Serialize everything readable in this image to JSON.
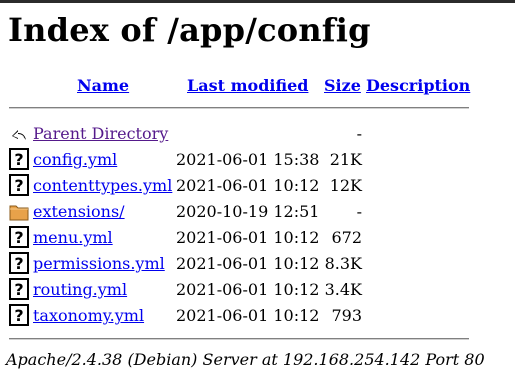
{
  "page": {
    "title": "Index of /app/config"
  },
  "columns": {
    "name": "Name",
    "last_modified": "Last modified",
    "size": "Size",
    "description": "Description"
  },
  "rows": [
    {
      "name": "Parent Directory",
      "modified": "",
      "size": "-",
      "icon": "back-arrow-icon"
    },
    {
      "name": "config.yml",
      "modified": "2021-06-01 15:38",
      "size": "21K",
      "icon": "unknown-file-icon"
    },
    {
      "name": "contenttypes.yml",
      "modified": "2021-06-01 10:12",
      "size": "12K",
      "icon": "unknown-file-icon"
    },
    {
      "name": "extensions/",
      "modified": "2020-10-19 12:51",
      "size": "-",
      "icon": "folder-icon"
    },
    {
      "name": "menu.yml",
      "modified": "2021-06-01 10:12",
      "size": "672",
      "icon": "unknown-file-icon"
    },
    {
      "name": "permissions.yml",
      "modified": "2021-06-01 10:12",
      "size": "8.3K",
      "icon": "unknown-file-icon"
    },
    {
      "name": "routing.yml",
      "modified": "2021-06-01 10:12",
      "size": "3.4K",
      "icon": "unknown-file-icon"
    },
    {
      "name": "taxonomy.yml",
      "modified": "2021-06-01 10:12",
      "size": "793",
      "icon": "unknown-file-icon"
    }
  ],
  "footer": {
    "address": "Apache/2.4.38 (Debian) Server at 192.168.254.142 Port 80"
  },
  "colors": {
    "link": "#0000ee",
    "visited_link": "#551a8b",
    "folder": "#e8a24a"
  }
}
